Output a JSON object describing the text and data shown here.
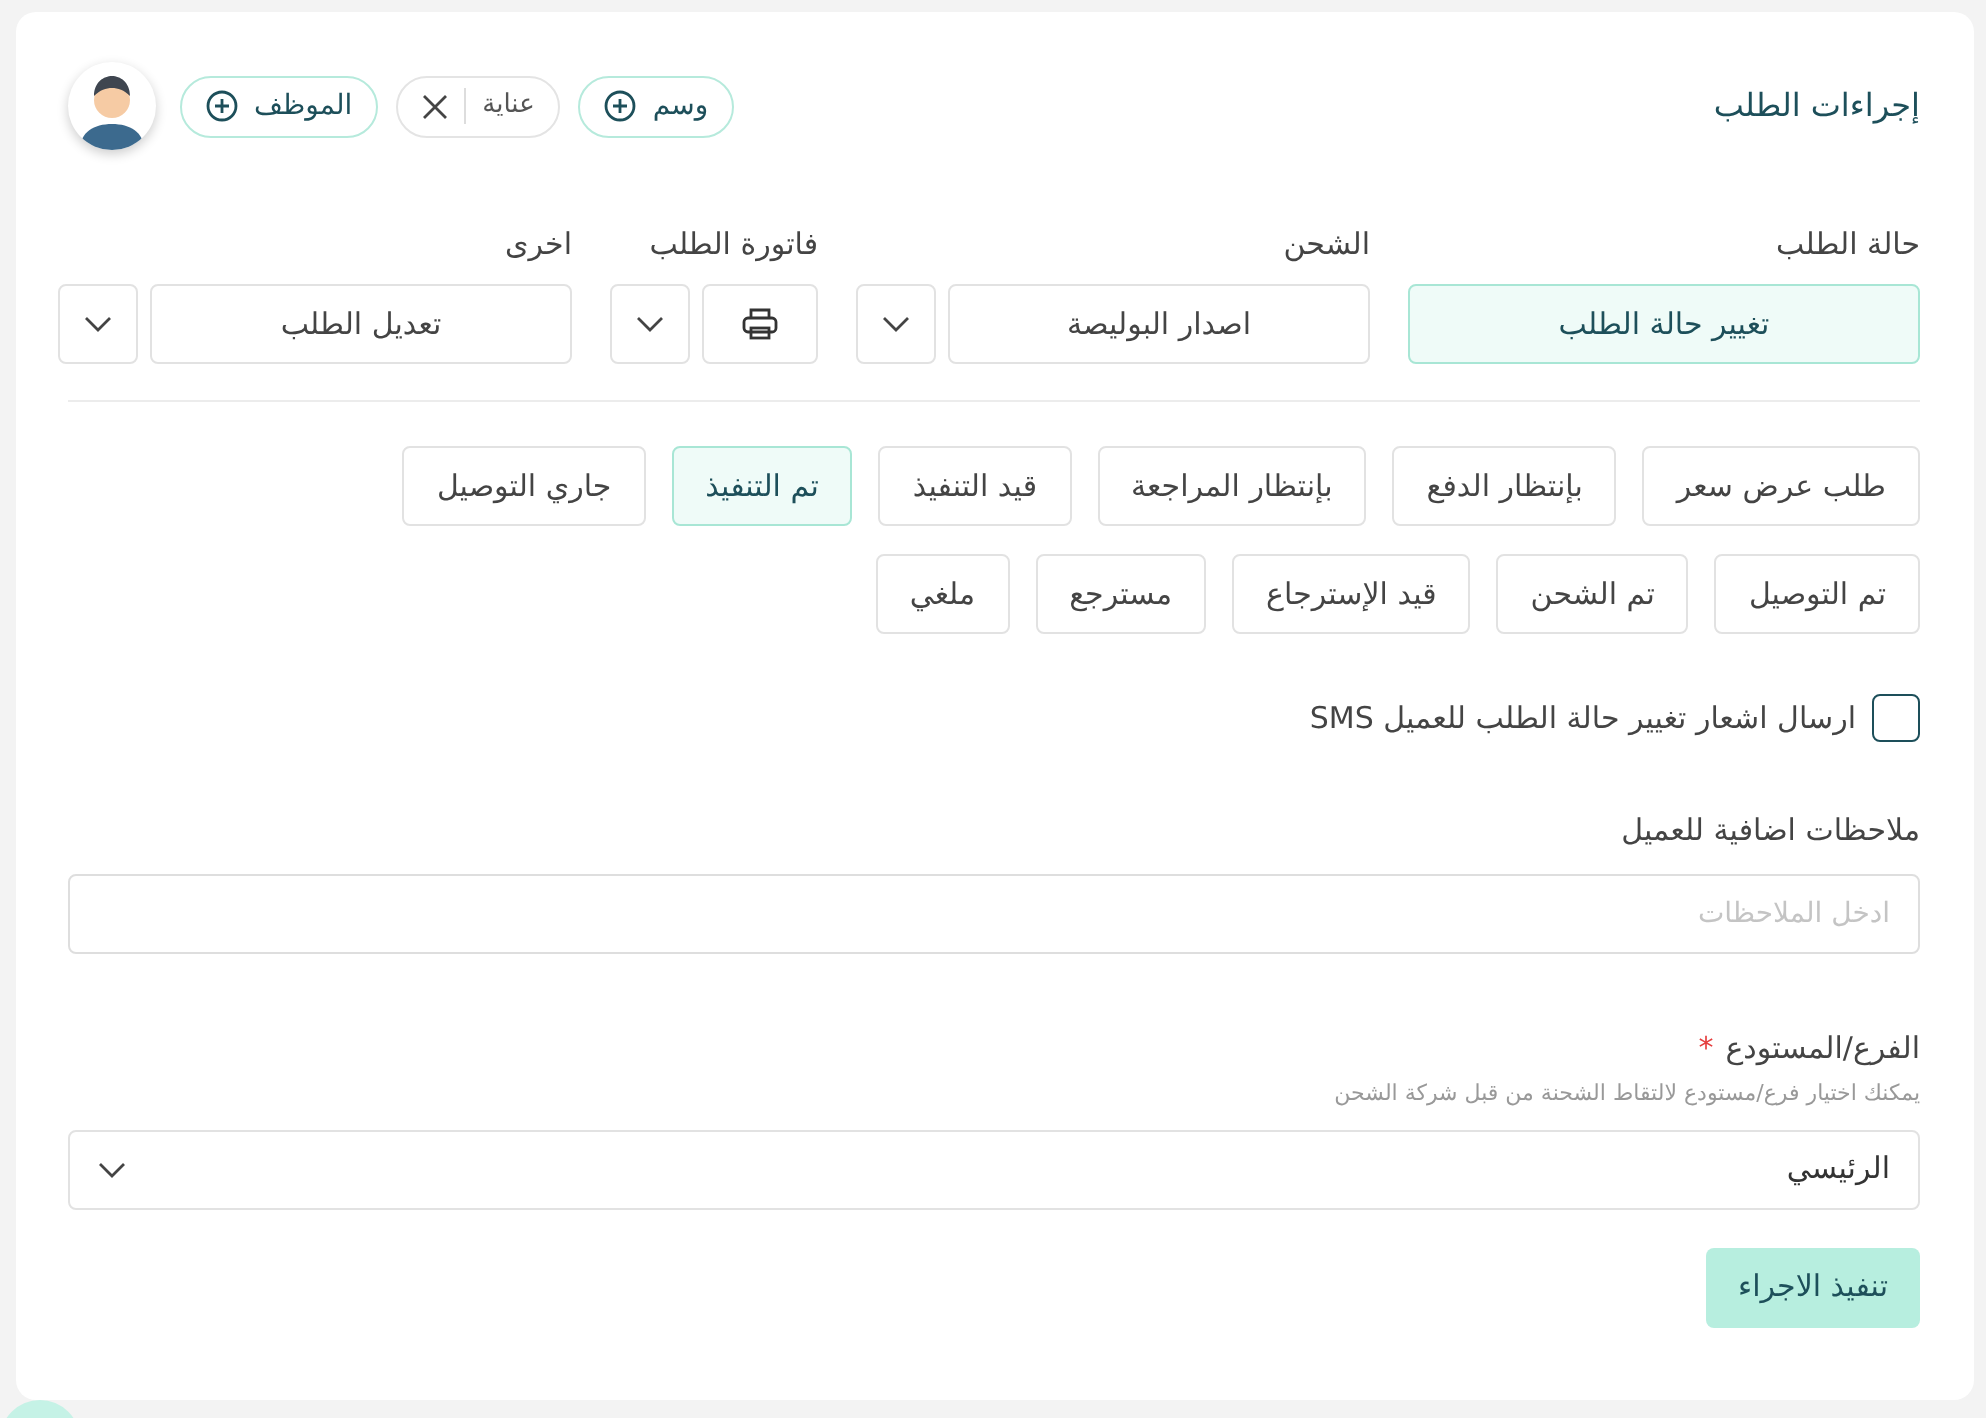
{
  "title": "إجراءات الطلب",
  "tags": [
    {
      "kind": "add",
      "label": "وسم"
    },
    {
      "kind": "removable",
      "label": "عناية"
    },
    {
      "kind": "add",
      "label": "الموظف"
    }
  ],
  "action_groups": [
    {
      "label": "حالة الطلب",
      "kind": "text",
      "button": "تغيير حالة الطلب",
      "selected": true,
      "has_dropdown": false
    },
    {
      "label": "الشحن",
      "kind": "text",
      "button": "اصدار البوليصة",
      "selected": false,
      "has_dropdown": true
    },
    {
      "label": "فاتورة الطلب",
      "kind": "print",
      "selected": false,
      "has_dropdown": true
    },
    {
      "label": "اخرى",
      "kind": "text",
      "button": "تعديل الطلب",
      "selected": false,
      "has_dropdown": true
    }
  ],
  "statuses": [
    {
      "label": "طلب عرض سعر",
      "selected": false
    },
    {
      "label": "بإنتظار الدفع",
      "selected": false
    },
    {
      "label": "بإنتظار المراجعة",
      "selected": false
    },
    {
      "label": "قيد التنفيذ",
      "selected": false
    },
    {
      "label": "تم التنفيذ",
      "selected": true
    },
    {
      "label": "جاري التوصيل",
      "selected": false
    },
    {
      "label": "تم التوصيل",
      "selected": false
    },
    {
      "label": "تم الشحن",
      "selected": false
    },
    {
      "label": "قيد الإسترجاع",
      "selected": false
    },
    {
      "label": "مسترجع",
      "selected": false
    },
    {
      "label": "ملغي",
      "selected": false
    }
  ],
  "sms": {
    "label": "ارسال اشعار تغيير حالة الطلب للعميل SMS",
    "checked": false
  },
  "notes": {
    "label": "ملاحظات اضافية للعميل",
    "placeholder": "ادخل الملاحظات"
  },
  "branch": {
    "label": "الفرع/المستودع",
    "required": true,
    "required_mark": "*",
    "hint": "يمكنك اختيار فرع/مستودع لالتقاط الشحنة من قبل شركة الشحن",
    "value": "الرئيسي"
  },
  "submit": "تنفيذ الاجراء"
}
